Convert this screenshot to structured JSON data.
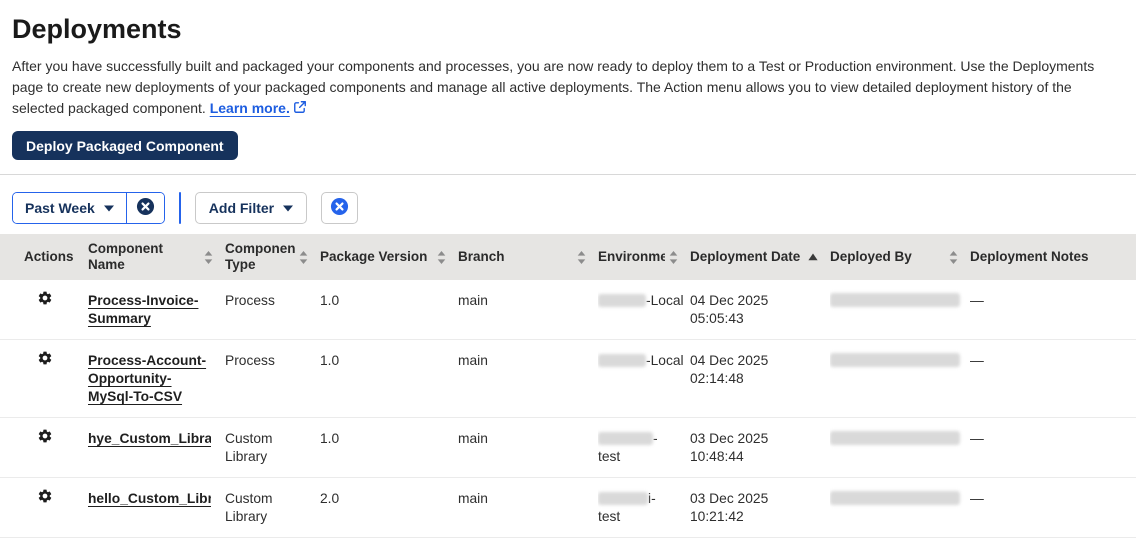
{
  "page": {
    "title": "Deployments",
    "description": "After you have successfully built and packaged your components and processes, you are now ready to deploy them to a Test or Production environment. Use the Deployments page to create new deployments of your packaged components and manage all active deployments. The Action menu allows you to view detailed deployment history of the selected packaged component.",
    "learn_more_label": "Learn more."
  },
  "toolbar": {
    "deploy_button_label": "Deploy Packaged Component"
  },
  "filters": {
    "date_filter_label": "Past Week",
    "add_filter_label": "Add Filter"
  },
  "colors": {
    "navy": "#16325c",
    "accent_blue": "#2563eb",
    "link_blue": "#1d5de0",
    "header_bg": "#e6e5e3"
  },
  "table": {
    "columns": [
      {
        "key": "actions",
        "label": "Actions",
        "sortable": false
      },
      {
        "key": "name",
        "label": "Component Name",
        "sortable": true
      },
      {
        "key": "type",
        "label": "Component Type",
        "sortable": true
      },
      {
        "key": "version",
        "label": "Package Version",
        "sortable": true
      },
      {
        "key": "branch",
        "label": "Branch",
        "sortable": true
      },
      {
        "key": "environment",
        "label": "Environment",
        "sortable": true
      },
      {
        "key": "date",
        "label": "Deployment Date",
        "sortable": true,
        "sorted": "asc"
      },
      {
        "key": "deployed_by",
        "label": "Deployed By",
        "sortable": true
      },
      {
        "key": "notes",
        "label": "Deployment Notes",
        "sortable": false
      }
    ],
    "rows": [
      {
        "component_name": "Process-Invoice-Summary",
        "component_type": "Process",
        "package_version": "1.0",
        "branch": "main",
        "environment": {
          "redacted": true,
          "redacted_width": 48,
          "visible_lines": [
            "-Local"
          ]
        },
        "deployment_date_lines": [
          "04 Dec 2025",
          "05:05:43"
        ],
        "deployed_by_redacted": true,
        "deployment_notes": "—"
      },
      {
        "component_name": "Process-Account-Opportunity-MySql-To-CSV",
        "component_type": "Process",
        "package_version": "1.0",
        "branch": "main",
        "environment": {
          "redacted": true,
          "redacted_width": 48,
          "visible_lines": [
            "-Local"
          ]
        },
        "deployment_date_lines": [
          "04 Dec 2025",
          "02:14:48"
        ],
        "deployed_by_redacted": true,
        "deployment_notes": "—"
      },
      {
        "component_name": "hye_Custom_Library",
        "component_type": "Custom Library",
        "package_version": "1.0",
        "branch": "main",
        "environment": {
          "redacted": true,
          "redacted_width": 55,
          "visible_lines": [
            "-",
            "test"
          ]
        },
        "deployment_date_lines": [
          "03 Dec 2025",
          "10:48:44"
        ],
        "deployed_by_redacted": true,
        "deployment_notes": "—"
      },
      {
        "component_name": "hello_Custom_Library",
        "component_type": "Custom Library",
        "package_version": "2.0",
        "branch": "main",
        "environment": {
          "redacted": true,
          "redacted_width": 50,
          "visible_lines": [
            "i-",
            "test"
          ]
        },
        "deployment_date_lines": [
          "03 Dec 2025",
          "10:21:42"
        ],
        "deployed_by_redacted": true,
        "deployment_notes": "—"
      }
    ]
  }
}
